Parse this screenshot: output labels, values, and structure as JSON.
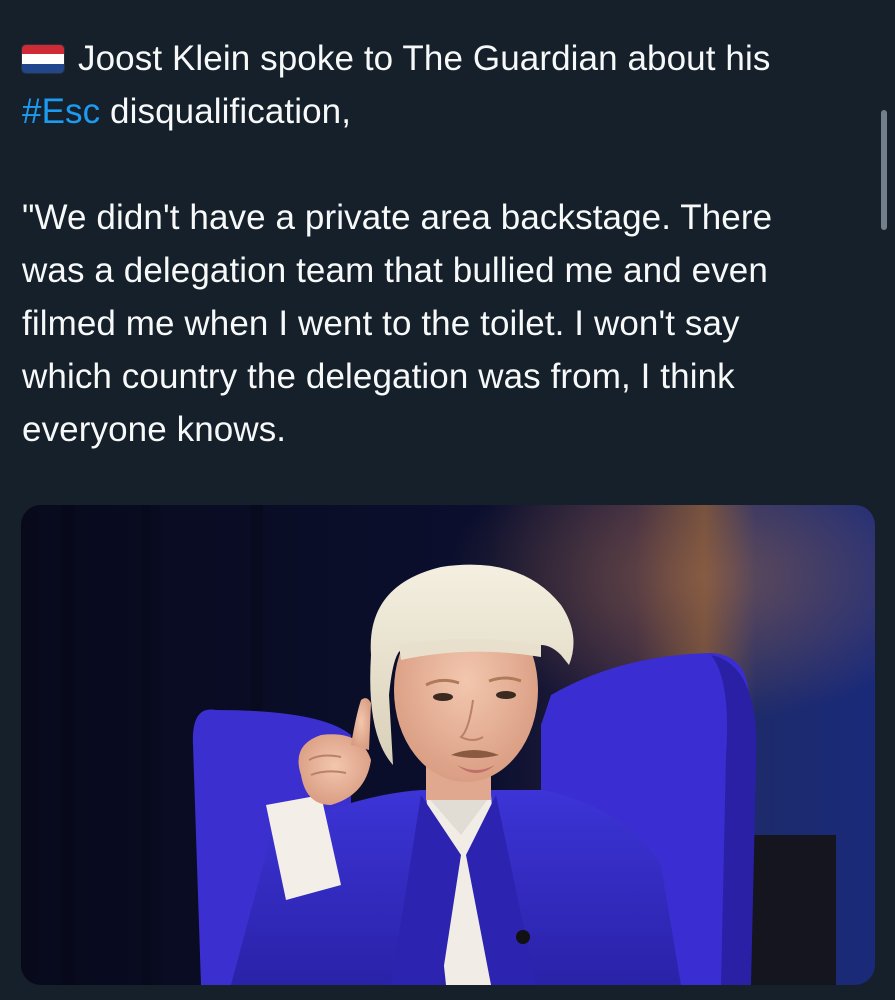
{
  "tweet": {
    "flag_icon": "netherlands-flag-emoji",
    "line1": "Joost Klein spoke to The Guardian about his",
    "hashtag": "#Esc",
    "line2_rest": " disqualification,",
    "quote_lines": [
      "\"We didn't have a private area backstage. There",
      "was a delegation team that bullied me and even",
      "filmed me when I went to the toilet. I won't say",
      "which country the delegation was from, I think",
      "everyone knows."
    ]
  },
  "media": {
    "type": "photo",
    "subject": "platinum-haired performer in a blue suit gesturing with raised finger"
  },
  "colors": {
    "background": "#15202b",
    "text": "#f7f9f9",
    "link": "#1d9bf0"
  }
}
